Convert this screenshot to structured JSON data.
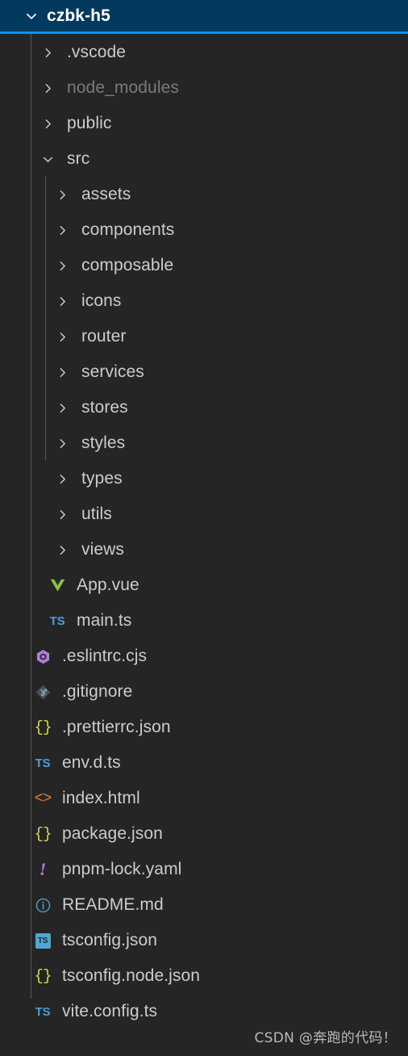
{
  "header": {
    "title": "czbk-h5",
    "expanded": true,
    "chevron": "chevron-down-icon",
    "bg_color": "#04395E",
    "accent_color": "#0097FB"
  },
  "theme": {
    "background": "#252526",
    "text_color": "#ccccca",
    "dimmed_text_color": "#7b7b7b",
    "indent_guide_color": "#585858"
  },
  "tree": [
    {
      "name": ".vscode",
      "kind": "folder",
      "level": 1,
      "expanded": false,
      "icon": "chevron-right-icon",
      "dimmed": false
    },
    {
      "name": "node_modules",
      "kind": "folder",
      "level": 1,
      "expanded": false,
      "icon": "chevron-right-icon",
      "dimmed": true
    },
    {
      "name": "public",
      "kind": "folder",
      "level": 1,
      "expanded": false,
      "icon": "chevron-right-icon",
      "dimmed": false
    },
    {
      "name": "src",
      "kind": "folder",
      "level": 1,
      "expanded": true,
      "icon": "chevron-down-icon",
      "dimmed": false
    },
    {
      "name": "assets",
      "kind": "folder",
      "level": 2,
      "expanded": false,
      "icon": "chevron-right-icon",
      "dimmed": false
    },
    {
      "name": "components",
      "kind": "folder",
      "level": 2,
      "expanded": false,
      "icon": "chevron-right-icon",
      "dimmed": false
    },
    {
      "name": "composable",
      "kind": "folder",
      "level": 2,
      "expanded": false,
      "icon": "chevron-right-icon",
      "dimmed": false
    },
    {
      "name": "icons",
      "kind": "folder",
      "level": 2,
      "expanded": false,
      "icon": "chevron-right-icon",
      "dimmed": false
    },
    {
      "name": "router",
      "kind": "folder",
      "level": 2,
      "expanded": false,
      "icon": "chevron-right-icon",
      "dimmed": false
    },
    {
      "name": "services",
      "kind": "folder",
      "level": 2,
      "expanded": false,
      "icon": "chevron-right-icon",
      "dimmed": false
    },
    {
      "name": "stores",
      "kind": "folder",
      "level": 2,
      "expanded": false,
      "icon": "chevron-right-icon",
      "dimmed": false
    },
    {
      "name": "styles",
      "kind": "folder",
      "level": 2,
      "expanded": false,
      "icon": "chevron-right-icon",
      "dimmed": false
    },
    {
      "name": "types",
      "kind": "folder",
      "level": 2,
      "expanded": false,
      "icon": "chevron-right-icon",
      "dimmed": false
    },
    {
      "name": "utils",
      "kind": "folder",
      "level": 2,
      "expanded": false,
      "icon": "chevron-right-icon",
      "dimmed": false
    },
    {
      "name": "views",
      "kind": "folder",
      "level": 2,
      "expanded": false,
      "icon": "chevron-right-icon",
      "dimmed": false
    },
    {
      "name": "App.vue",
      "kind": "file",
      "level": 2,
      "icon": "vue-file-icon",
      "icon_color": "#8DC149",
      "dimmed": false
    },
    {
      "name": "main.ts",
      "kind": "file",
      "level": 2,
      "icon": "typescript-file-icon",
      "icon_color": "#4A9FD4",
      "dimmed": false
    },
    {
      "name": ".eslintrc.cjs",
      "kind": "file",
      "level": 1,
      "icon": "eslint-file-icon",
      "icon_color": "#B07FD6",
      "dimmed": false
    },
    {
      "name": ".gitignore",
      "kind": "file",
      "level": 1,
      "icon": "git-file-icon",
      "icon_color": "#41535B",
      "dimmed": false
    },
    {
      "name": ".prettierrc.json",
      "kind": "file",
      "level": 1,
      "icon": "json-file-icon",
      "icon_color": "#D8D84B",
      "dimmed": false
    },
    {
      "name": "env.d.ts",
      "kind": "file",
      "level": 1,
      "icon": "typescript-file-icon",
      "icon_color": "#4A9FD4",
      "dimmed": false
    },
    {
      "name": "index.html",
      "kind": "file",
      "level": 1,
      "icon": "html-file-icon",
      "icon_color": "#E37933",
      "dimmed": false
    },
    {
      "name": "package.json",
      "kind": "file",
      "level": 1,
      "icon": "json-file-icon",
      "icon_color": "#D8D84B",
      "dimmed": false
    },
    {
      "name": "pnpm-lock.yaml",
      "kind": "file",
      "level": 1,
      "icon": "yaml-lock-file-icon",
      "icon_color": "#B07FD6",
      "dimmed": false
    },
    {
      "name": "README.md",
      "kind": "file",
      "level": 1,
      "icon": "info-file-icon",
      "icon_color": "#51A5D0",
      "dimmed": false
    },
    {
      "name": "tsconfig.json",
      "kind": "file",
      "level": 1,
      "icon": "tsconfig-file-icon",
      "icon_color": "#51A5D0",
      "dimmed": false
    },
    {
      "name": "tsconfig.node.json",
      "kind": "file",
      "level": 1,
      "icon": "json-file-icon",
      "icon_color": "#D8D84B",
      "dimmed": false
    },
    {
      "name": "vite.config.ts",
      "kind": "file",
      "level": 1,
      "icon": "typescript-file-icon",
      "icon_color": "#4A9FD4",
      "dimmed": false
    }
  ],
  "watermark": {
    "text": "CSDN @奔跑的代码！"
  }
}
